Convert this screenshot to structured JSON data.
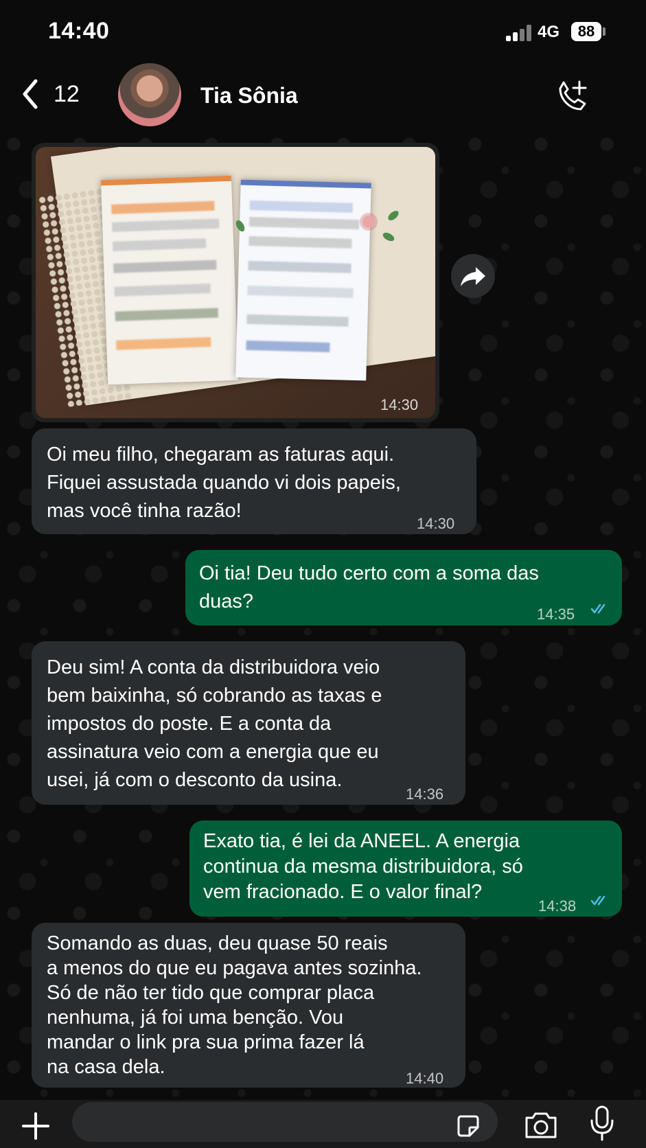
{
  "status": {
    "time": "14:40",
    "network": "4G",
    "battery": "88"
  },
  "header": {
    "back_count": "12",
    "contact_name": "Tia Sônia",
    "icons": {
      "back": "chevron-left-icon",
      "call": "add-call-icon"
    }
  },
  "messages": [
    {
      "type": "image",
      "time": "14:30"
    },
    {
      "type": "incoming",
      "lines": [
        "Oi meu filho, chegaram as faturas aqui.",
        "Fiquei assustada quando vi dois papeis,",
        "mas você tinha razão!"
      ],
      "time": "14:30"
    },
    {
      "type": "outgoing",
      "lines": [
        "Oi tia! Deu tudo certo com a soma das",
        "duas?"
      ],
      "time": "14:35",
      "status": "read"
    },
    {
      "type": "incoming",
      "lines": [
        "Deu sim! A conta da distribuidora veio",
        "bem baixinha, só cobrando as taxas e",
        "impostos do poste. E a conta da",
        "assinatura veio com a energia que eu",
        "usei, já com o desconto da usina."
      ],
      "time": "14:36"
    },
    {
      "type": "outgoing",
      "lines": [
        "Exato tia, é lei da ANEEL. A energia",
        "continua da mesma distribuidora, só",
        "vem fracionado. E o valor final?"
      ],
      "time": "14:38",
      "status": "read"
    },
    {
      "type": "incoming",
      "lines": [
        "Somando as duas, deu quase 50 reais",
        "a menos do que eu pagava antes sozinha.",
        "Só de não ter tido que comprar placa",
        "nenhuma, já foi uma benção. Vou",
        "mandar o link pra sua prima fazer lá",
        "na casa dela."
      ],
      "time": "14:40"
    }
  ],
  "composer": {
    "placeholder": "",
    "icons": {
      "plus": "plus-icon",
      "sticker": "sticker-icon",
      "camera": "camera-icon",
      "mic": "microphone-icon"
    }
  },
  "colors": {
    "incoming_bubble": "#2a2d2f",
    "outgoing_bubble": "#005f3a",
    "read_ticks": "#53bdeb"
  }
}
